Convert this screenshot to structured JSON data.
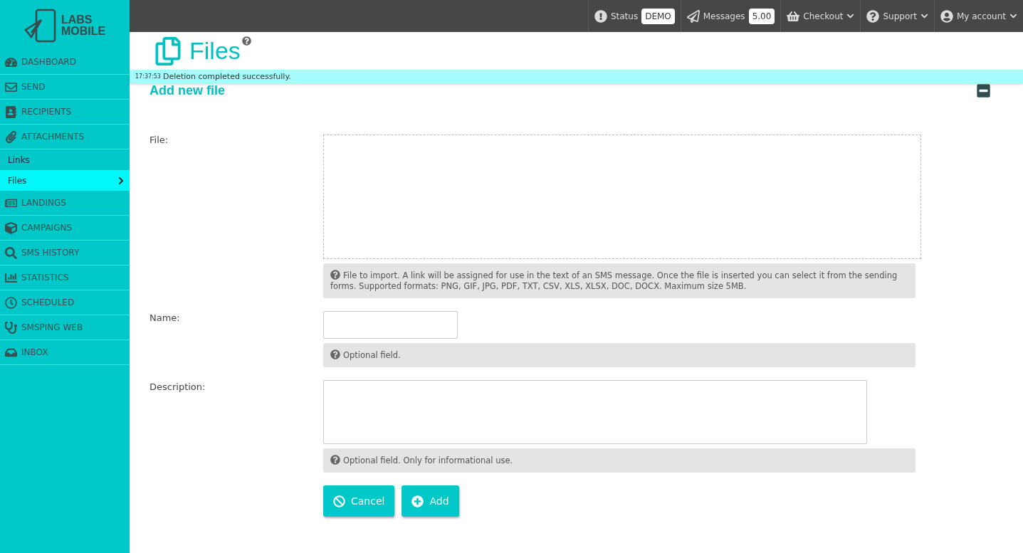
{
  "logo": {
    "line1": "LABS",
    "line2": "MOBILE"
  },
  "topbar": [
    {
      "kind": "badge",
      "label": "Status",
      "badge": "DEMO"
    },
    {
      "kind": "badge",
      "label": "Messages",
      "badge": "5.00"
    },
    {
      "kind": "dropdown",
      "label": "Checkout"
    },
    {
      "kind": "dropdown",
      "label": "Support"
    },
    {
      "kind": "dropdown",
      "label": "My account"
    }
  ],
  "sidebar": {
    "items": [
      {
        "kind": "section",
        "label": "DASHBOARD",
        "selected": false
      },
      {
        "kind": "section",
        "label": "SEND",
        "selected": false
      },
      {
        "kind": "section",
        "label": "RECIPIENTS",
        "selected": false
      },
      {
        "kind": "section",
        "label": "ATTACHMENTS",
        "selected": false
      },
      {
        "kind": "sub",
        "label": "Links",
        "selected": false
      },
      {
        "kind": "sub",
        "label": "Files",
        "selected": true
      },
      {
        "kind": "section",
        "label": "LANDINGS",
        "selected": false
      },
      {
        "kind": "section",
        "label": "CAMPAIGNS",
        "selected": false
      },
      {
        "kind": "section",
        "label": "SMS HISTORY",
        "selected": false
      },
      {
        "kind": "section",
        "label": "STATISTICS",
        "selected": false
      },
      {
        "kind": "section",
        "label": "SCHEDULED",
        "selected": false
      },
      {
        "kind": "section",
        "label": "SMSPING WEB",
        "selected": false
      },
      {
        "kind": "section",
        "label": "INBOX",
        "selected": false
      }
    ]
  },
  "page": {
    "title": "Files"
  },
  "notification": {
    "time": "17:37:53",
    "message": "Deletion completed successfully."
  },
  "form": {
    "title": "Add new file",
    "fields": [
      {
        "kind": "dropzone",
        "label": "File:",
        "help": "File to import. A link will be assigned for use in the text of an SMS message. Once the file is inserted you can select it from the sending forms. Supported formats: PNG, GIF, JPG, PDF, TXT, CSV, XLS, XLSX, DOC, DOCX. Maximum size 5MB."
      },
      {
        "kind": "text",
        "label": "Name:",
        "help": "Optional field."
      },
      {
        "kind": "textarea",
        "label": "Description:",
        "help": "Optional field. Only for informational use."
      }
    ],
    "buttons": [
      {
        "kind": "cancel",
        "label": "Cancel"
      },
      {
        "kind": "add",
        "label": "Add"
      }
    ]
  }
}
